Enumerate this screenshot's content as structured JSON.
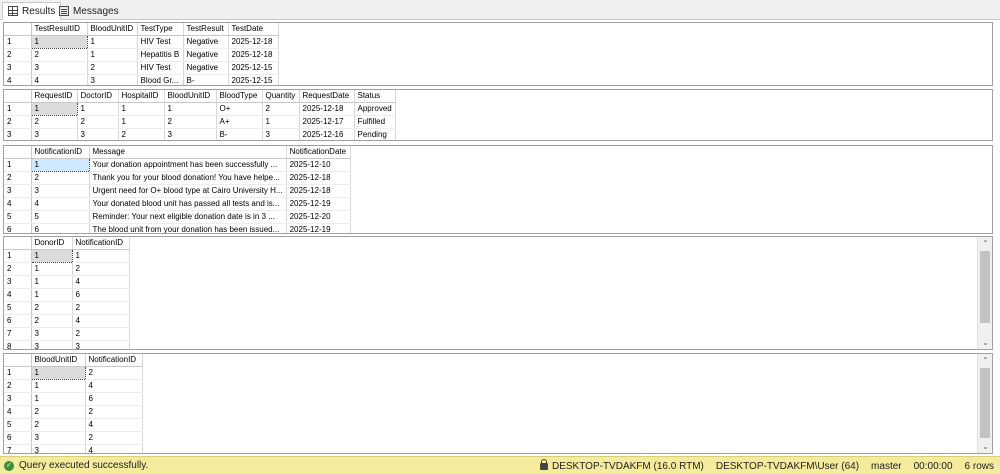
{
  "tabs": [
    {
      "label": "Results",
      "icon": "grid-icon"
    },
    {
      "label": "Messages",
      "icon": "messages-icon"
    }
  ],
  "grids": [
    {
      "columns": [
        "TestResultID",
        "BloodUnitID",
        "TestType",
        "TestResult",
        "TestDate"
      ],
      "rows": [
        [
          "1",
          "1",
          "1",
          "HIV Test",
          "Negative",
          "2025-12-18"
        ],
        [
          "2",
          "2",
          "1",
          "Hepatitis B",
          "Negative",
          "2025-12-18"
        ],
        [
          "3",
          "3",
          "2",
          "HIV Test",
          "Negative",
          "2025-12-15"
        ],
        [
          "4",
          "4",
          "3",
          "Blood Gr...",
          "B-",
          "2025-12-15"
        ]
      ]
    },
    {
      "columns": [
        "RequestID",
        "DoctorID",
        "HospitalID",
        "BloodUnitID",
        "BloodType",
        "Quantity",
        "RequestDate",
        "Status"
      ],
      "rows": [
        [
          "1",
          "1",
          "1",
          "1",
          "1",
          "O+",
          "2",
          "2025-12-18",
          "Approved"
        ],
        [
          "2",
          "2",
          "2",
          "1",
          "2",
          "A+",
          "1",
          "2025-12-17",
          "Fulfilled"
        ],
        [
          "3",
          "3",
          "3",
          "2",
          "3",
          "B-",
          "3",
          "2025-12-16",
          "Pending"
        ]
      ]
    },
    {
      "columns": [
        "NotificationID",
        "Message",
        "NotificationDate"
      ],
      "rows": [
        [
          "1",
          "1",
          "Your donation appointment has been successfully ...",
          "2025-12-10"
        ],
        [
          "2",
          "2",
          "Thank you for your blood donation! You have helpe...",
          "2025-12-18"
        ],
        [
          "3",
          "3",
          "Urgent need for O+ blood type at Cairo University H...",
          "2025-12-18"
        ],
        [
          "4",
          "4",
          "Your donated blood unit has passed all tests and is...",
          "2025-12-19"
        ],
        [
          "5",
          "5",
          "Reminder: Your next eligible donation date is in 3 ...",
          "2025-12-20"
        ],
        [
          "6",
          "6",
          "The blood unit from your donation has been issued...",
          "2025-12-19"
        ]
      ]
    },
    {
      "columns": [
        "DonorID",
        "NotificationID"
      ],
      "rows": [
        [
          "1",
          "1",
          "1"
        ],
        [
          "2",
          "1",
          "2"
        ],
        [
          "3",
          "1",
          "4"
        ],
        [
          "4",
          "1",
          "6"
        ],
        [
          "5",
          "2",
          "2"
        ],
        [
          "6",
          "2",
          "4"
        ],
        [
          "7",
          "3",
          "2"
        ],
        [
          "8",
          "3",
          "3"
        ]
      ]
    },
    {
      "columns": [
        "BloodUnitID",
        "NotificationID"
      ],
      "rows": [
        [
          "1",
          "1",
          "2"
        ],
        [
          "2",
          "1",
          "4"
        ],
        [
          "3",
          "1",
          "6"
        ],
        [
          "4",
          "2",
          "2"
        ],
        [
          "5",
          "2",
          "4"
        ],
        [
          "6",
          "3",
          "2"
        ],
        [
          "7",
          "3",
          "4"
        ]
      ]
    }
  ],
  "status": {
    "message": "Query executed successfully.",
    "server": "DESKTOP-TVDAKFM (16.0 RTM)",
    "user": "DESKTOP-TVDAKFM\\User (64)",
    "database": "master",
    "elapsed": "00:00:00",
    "rows": "6 rows"
  }
}
